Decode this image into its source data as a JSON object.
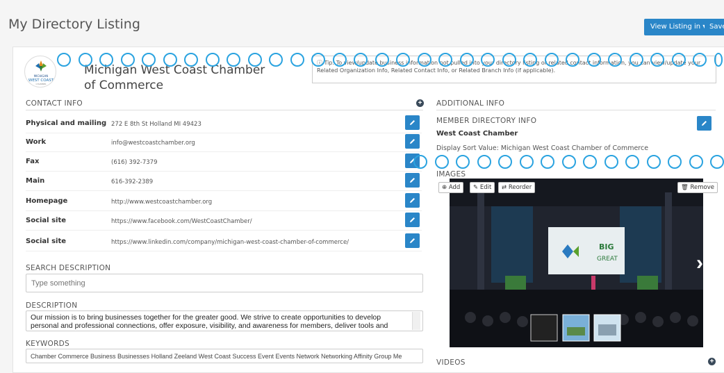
{
  "header": {
    "title": "My Directory Listing",
    "view_listing_label": "View Listing in ▾",
    "save_label": "Save"
  },
  "org": {
    "name": "Michigan West Coast Chamber of Commerce",
    "logo_text": "MICHIGAN",
    "logo_text2": "WEST COAST",
    "logo_sub": "CHAMBER"
  },
  "note": "ⓘ Tip: To view/update business information not pulled into your directory listing or related contact information, you can view/update your Related Organization Info, Related Contact Info, or Related Branch Info (if applicable).",
  "contact": {
    "heading": "CONTACT INFO",
    "rows": [
      {
        "label": "Physical and mailing",
        "value": "272 E 8th St Holland MI 49423"
      },
      {
        "label": "Work",
        "value": "info@westcoastchamber.org"
      },
      {
        "label": "Fax",
        "value": "(616) 392-7379"
      },
      {
        "label": "Main",
        "value": "616-392-2389"
      },
      {
        "label": "Homepage",
        "value": "http://www.westcoastchamber.org"
      },
      {
        "label": "Social site",
        "value": "https://www.facebook.com/WestCoastChamber/"
      },
      {
        "label": "Social site",
        "value": "https://www.linkedin.com/company/michigan-west-coast-chamber-of-commerce/"
      }
    ]
  },
  "search_description": {
    "heading": "SEARCH DESCRIPTION",
    "placeholder": "Type something"
  },
  "description": {
    "heading": "DESCRIPTION",
    "text": "Our mission is to bring businesses together for the greater good. We strive to create opportunities to develop personal and professional connections, offer exposure, visibility, and awareness for members, deliver tools and information for"
  },
  "keywords": {
    "heading": "KEYWORDS",
    "value": "Chamber Commerce Business Businesses Holland Zeeland West Coast Success Event Events Network Networking Affinity Group Me"
  },
  "additional": {
    "heading": "ADDITIONAL INFO",
    "member_heading": "MEMBER DIRECTORY INFO",
    "member_name": "West Coast Chamber",
    "sort_value": "Display Sort Value: Michigan West Coast Chamber of Commerce"
  },
  "images": {
    "heading": "IMAGES",
    "add": "Add",
    "edit": "Edit",
    "reorder": "Reorder",
    "remove": "Remove",
    "screen_text": "Think BIG + GREAT"
  },
  "videos": {
    "heading": "VIDEOS"
  },
  "colors": {
    "accent": "#2a86c8",
    "circle": "#2aa3e0"
  }
}
